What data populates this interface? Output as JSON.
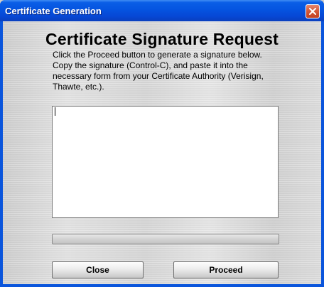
{
  "window": {
    "title": "Certificate Generation"
  },
  "dialog": {
    "heading": "Certificate Signature Request",
    "instructions": "Click the Proceed button to generate a signature below. Copy the signature (Control-C), and paste it into the necessary form from your Certificate Authority (Verisign, Thawte, etc.).",
    "signature_value": "",
    "progress_fraction": 0
  },
  "buttons": {
    "close_label": "Close",
    "proceed_label": "Proceed"
  },
  "icons": {
    "title_close": "close-icon"
  },
  "colors": {
    "titlebar": "#0554e0",
    "close_button": "#d55a3a",
    "panel": "#dcdcdc"
  }
}
